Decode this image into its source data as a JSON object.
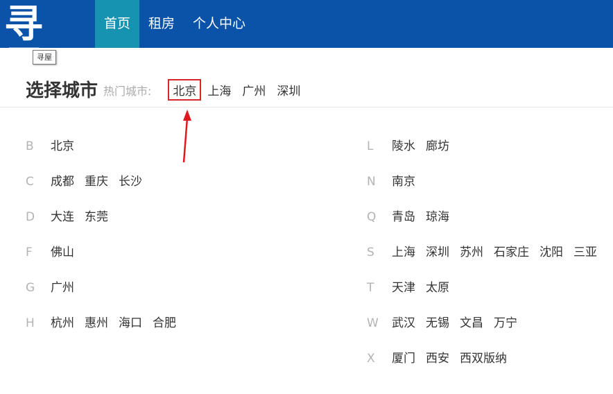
{
  "header": {
    "logo_text": "寻屋",
    "nav": [
      {
        "label": "首页"
      },
      {
        "label": "租房"
      },
      {
        "label": "个人中心"
      }
    ],
    "tooltip": "寻屋",
    "colors": {
      "bar": "#0a53a8",
      "active": "#1593b0",
      "highlight": "#d9262b"
    }
  },
  "page": {
    "title": "选择城市",
    "hot_label": "热门城市:",
    "hot_cities": [
      "北京",
      "上海",
      "广州",
      "深圳"
    ]
  },
  "city_groups": {
    "left": [
      {
        "letter": "B",
        "cities": [
          "北京"
        ]
      },
      {
        "letter": "C",
        "cities": [
          "成都",
          "重庆",
          "长沙"
        ]
      },
      {
        "letter": "D",
        "cities": [
          "大连",
          "东莞"
        ]
      },
      {
        "letter": "F",
        "cities": [
          "佛山"
        ]
      },
      {
        "letter": "G",
        "cities": [
          "广州"
        ]
      },
      {
        "letter": "H",
        "cities": [
          "杭州",
          "惠州",
          "海口",
          "合肥"
        ]
      }
    ],
    "right": [
      {
        "letter": "L",
        "cities": [
          "陵水",
          "廊坊"
        ]
      },
      {
        "letter": "N",
        "cities": [
          "南京"
        ]
      },
      {
        "letter": "Q",
        "cities": [
          "青岛",
          "琼海"
        ]
      },
      {
        "letter": "S",
        "cities": [
          "上海",
          "深圳",
          "苏州",
          "石家庄",
          "沈阳",
          "三亚"
        ]
      },
      {
        "letter": "T",
        "cities": [
          "天津",
          "太原"
        ]
      },
      {
        "letter": "W",
        "cities": [
          "武汉",
          "无锡",
          "文昌",
          "万宁"
        ]
      },
      {
        "letter": "X",
        "cities": [
          "厦门",
          "西安",
          "西双版纳"
        ]
      }
    ]
  }
}
